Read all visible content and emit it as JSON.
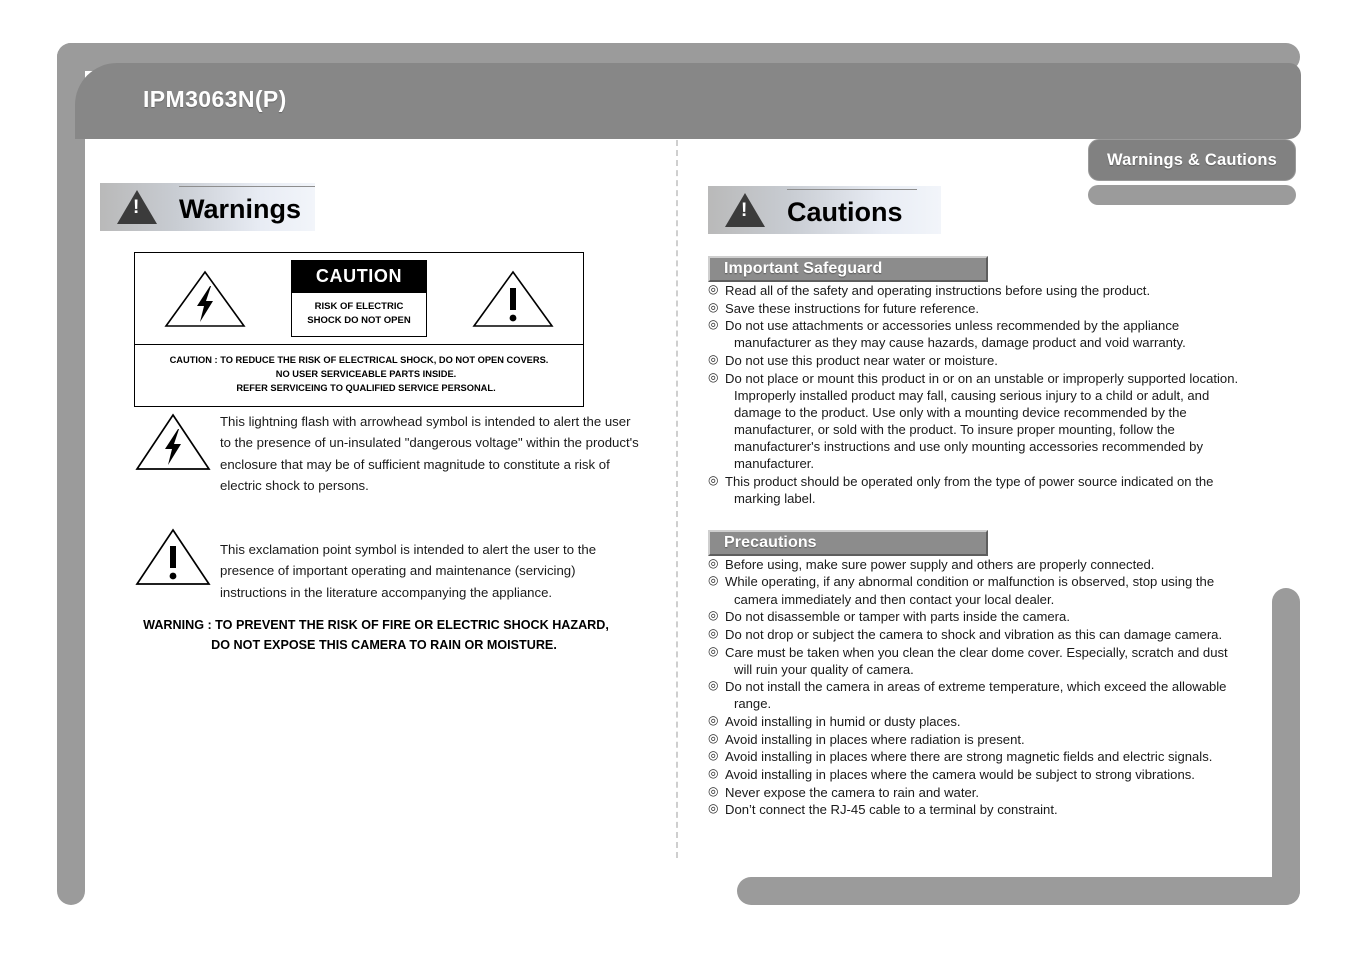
{
  "header": {
    "model_title": "IPM3063N(P)",
    "section_tab": "Warnings & Cautions"
  },
  "left_column": {
    "title": "Warnings",
    "title_icon": "warning-triangle-icon",
    "caution_box": {
      "left_symbol": "lightning-bolt-triangle-icon",
      "right_symbol": "exclamation-triangle-icon",
      "caution_label": "CAUTION",
      "risk_line_1": "RISK OF ELECTRIC",
      "risk_line_2": "SHOCK DO NOT OPEN",
      "footer_line_1": "CAUTION : TO REDUCE THE RISK OF ELECTRICAL SHOCK, DO NOT OPEN COVERS.",
      "footer_line_2": "NO USER SERVICEABLE PARTS INSIDE.",
      "footer_line_3": "REFER SERVICEING TO QUALIFIED SERVICE PERSONAL."
    },
    "symbol_notes": [
      {
        "icon": "lightning-bolt-triangle-icon",
        "text": "This lightning flash with arrowhead symbol is intended to alert the user to the presence of un-insulated \"dangerous voltage\" within the product's enclosure that may be of sufficient magnitude to constitute a risk of electric shock to persons."
      },
      {
        "icon": "exclamation-triangle-icon",
        "text": "This exclamation point symbol is intended to alert the user to the presence of important operating and maintenance (servicing) instructions in the literature accompanying the appliance."
      }
    ],
    "final_warning_line_1": "WARNING : TO PREVENT THE RISK OF FIRE OR ELECTRIC SHOCK HAZARD,",
    "final_warning_line_2": "DO NOT EXPOSE THIS CAMERA TO RAIN OR MOISTURE."
  },
  "right_column": {
    "title": "Cautions",
    "title_icon": "warning-triangle-icon",
    "bullet_glyph": "◎",
    "sections": [
      {
        "heading": "Important Safeguard",
        "items": [
          {
            "main": "Read all of the safety and operating instructions before using the product.",
            "cont": ""
          },
          {
            "main": "Save these instructions for future reference.",
            "cont": ""
          },
          {
            "main": "Do not use attachments or accessories unless recommended by the appliance",
            "cont": "manufacturer as they may cause hazards, damage product and void warranty."
          },
          {
            "main": "Do not use this product near water or moisture.",
            "cont": ""
          },
          {
            "main": "Do not place or mount this product in or on an unstable or improperly supported location.",
            "cont": "Improperly installed product may fall, causing serious injury to a child or adult, and damage to the product. Use only with a mounting device recommended by the manufacturer, or sold with the product. To insure proper mounting, follow the manufacturer's instructions and use only mounting accessories recommended by manufacturer."
          },
          {
            "main": "This product should be operated only from the type of power source indicated on the",
            "cont": "marking label."
          }
        ]
      },
      {
        "heading": "Precautions",
        "items": [
          {
            "main": "Before using, make sure power supply and others are properly connected.",
            "cont": ""
          },
          {
            "main": "While operating, if any abnormal condition or malfunction is observed, stop using the",
            "cont": "camera immediately and then contact your local dealer."
          },
          {
            "main": "Do not disassemble or tamper with parts inside the camera.",
            "cont": ""
          },
          {
            "main": "Do not drop or subject the camera to shock and vibration as this can damage camera.",
            "cont": ""
          },
          {
            "main": "Care must be taken when you clean the clear dome cover. Especially, scratch and dust",
            "cont": "will ruin your quality of camera."
          },
          {
            "main": "Do not install the camera in areas of extreme temperature, which exceed the allowable",
            "cont": "range."
          },
          {
            "main": "Avoid installing in humid or dusty places.",
            "cont": ""
          },
          {
            "main": "Avoid installing in places where radiation is present.",
            "cont": ""
          },
          {
            "main": "Avoid installing in places where there are strong magnetic fields and electric signals.",
            "cont": ""
          },
          {
            "main": "Avoid installing in places where the camera would be subject to strong vibrations.",
            "cont": ""
          },
          {
            "main": "Never expose the camera to rain and water.",
            "cont": ""
          },
          {
            "main": "Don’t connect the RJ-45 cable to a terminal by constraint.",
            "cont": ""
          }
        ]
      }
    ]
  },
  "colors": {
    "frame_light": "#9b9b9b",
    "frame_dark": "#878787",
    "tab": "#818181",
    "subheader": "#8c8c8c",
    "text": "#1a1a1a"
  }
}
